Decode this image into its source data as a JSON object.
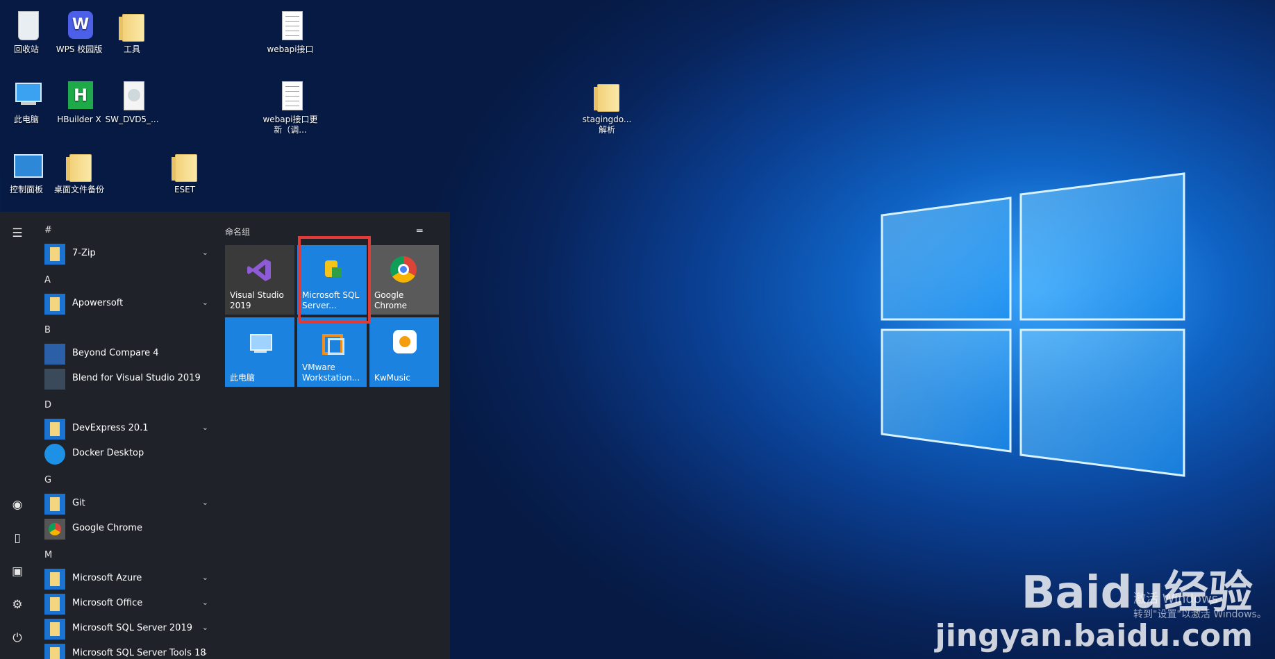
{
  "desktop": {
    "icons": [
      {
        "label": "回收站"
      },
      {
        "label": "WPS 校园版"
      },
      {
        "label": "工具"
      },
      {
        "label": "webapi接口"
      },
      {
        "label": "此电脑"
      },
      {
        "label": "HBuilder X"
      },
      {
        "label": "SW_DVD5_..."
      },
      {
        "label": "webapi接口更新（调..."
      },
      {
        "label": "stagingdo...解析"
      },
      {
        "label": "控制面板"
      },
      {
        "label": "桌面文件备份"
      },
      {
        "label": "ESET"
      }
    ]
  },
  "start_menu": {
    "apps": [
      {
        "header": "#"
      },
      {
        "label": "7-Zip",
        "expand": "⌄"
      },
      {
        "header": "A"
      },
      {
        "label": "Apowersoft",
        "expand": "⌄"
      },
      {
        "header": "B"
      },
      {
        "label": "Beyond Compare 4"
      },
      {
        "label": "Blend for Visual Studio 2019"
      },
      {
        "header": "D"
      },
      {
        "label": "DevExpress 20.1",
        "expand": "⌄"
      },
      {
        "label": "Docker Desktop"
      },
      {
        "header": "G"
      },
      {
        "label": "Git",
        "expand": "⌄"
      },
      {
        "label": "Google Chrome"
      },
      {
        "header": "M"
      },
      {
        "label": "Microsoft Azure",
        "expand": "⌄"
      },
      {
        "label": "Microsoft Office",
        "expand": "⌄"
      },
      {
        "label": "Microsoft SQL Server 2019",
        "expand": "⌄"
      },
      {
        "label": "Microsoft SQL Server Tools 18",
        "expand": "⌄"
      }
    ],
    "tile_group": "命名组",
    "tiles": [
      {
        "label": "Visual Studio 2019",
        "color": "#3a3a3a"
      },
      {
        "label": "Microsoft SQL Server...",
        "color": "#1b82e0"
      },
      {
        "label": "Google Chrome",
        "color": "#5a5a5a"
      },
      {
        "label": "此电脑",
        "color": "#1b82e0"
      },
      {
        "label": "VMware Workstation...",
        "color": "#1b82e0"
      },
      {
        "label": "KwMusic",
        "color": "#1b82e0"
      }
    ]
  },
  "watermark": {
    "brand": "Baidu经验",
    "url": "jingyan.baidu.com"
  },
  "activation": {
    "title": "激活 Windows",
    "subtitle": "转到\"设置\"以激活 Windows。"
  }
}
